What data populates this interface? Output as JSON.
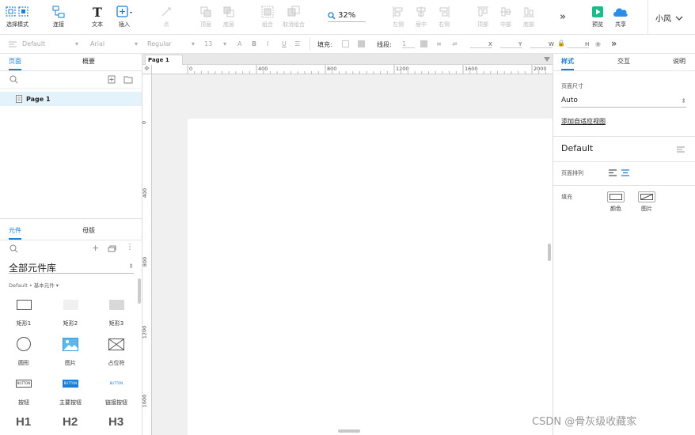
{
  "toolbar": {
    "select_mode": "选择模式",
    "connect": "连接",
    "text": "文本",
    "insert": "插入",
    "point": "点",
    "top_layer": "顶层",
    "bottom_layer": "底层",
    "group": "组合",
    "ungroup": "取消组合",
    "zoom": "32%",
    "align_left": "左侧",
    "align_center": "居中",
    "align_right": "右侧",
    "align_top": "顶部",
    "align_middle": "中部",
    "align_bottom": "底部",
    "preview": "预览",
    "share": "共享",
    "user": "小风"
  },
  "format_bar": {
    "style": "Default",
    "font": "Arial",
    "weight": "Regular",
    "size": "13",
    "fill_label": "填充:",
    "line_label": "线段:",
    "line_value": "1",
    "x": "X",
    "y": "Y",
    "w": "W",
    "h": "H"
  },
  "pages_panel": {
    "tab_pages": "页面",
    "tab_outline": "概要",
    "page_item": "Page 1"
  },
  "library_panel": {
    "tab_widgets": "元件",
    "tab_masters": "母版",
    "library_name": "全部元件库",
    "breadcrumb": "Default • 基本元件",
    "widgets": [
      "矩形1",
      "矩形2",
      "矩形3",
      "圆形",
      "图片",
      "占位符",
      "按钮",
      "主要按钮",
      "链接按钮"
    ],
    "button_text": "BUTTON",
    "headings": [
      "H1",
      "H2",
      "H3"
    ]
  },
  "canvas": {
    "tab": "Page 1",
    "ruler_top": [
      "0",
      "400",
      "800",
      "1200",
      "1600",
      "2000"
    ],
    "ruler_left": [
      "0",
      "400",
      "800",
      "1200",
      "1600"
    ]
  },
  "inspector": {
    "tab_style": "样式",
    "tab_interact": "交互",
    "tab_notes": "说明",
    "page_size_label": "页面尺寸",
    "page_size_value": "Auto",
    "adaptive_link": "添加自适应视图",
    "style_name": "Default",
    "page_align_label": "页面排列",
    "fill_label": "填充",
    "fill_color": "颜色",
    "fill_image": "图片"
  },
  "watermark": "CSDN @骨灰级收藏家",
  "colors": {
    "accent": "#1a7ed6",
    "preview": "#1bbc8b",
    "share": "#2a8de8"
  }
}
